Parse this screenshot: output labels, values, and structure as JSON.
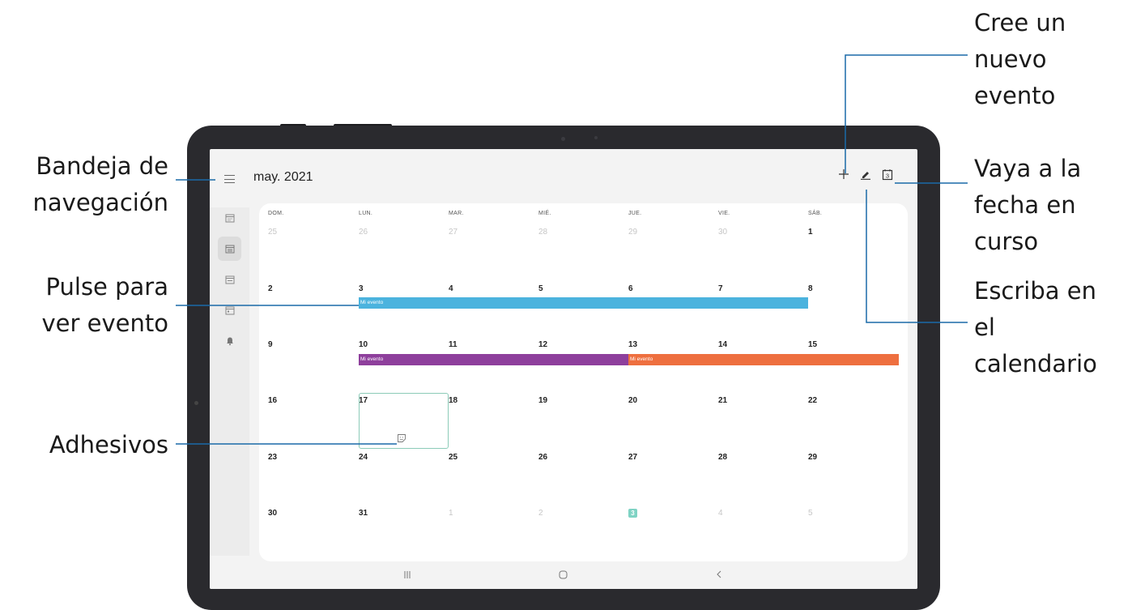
{
  "annotations": {
    "nav_drawer": "Bandeja de\nnavegación",
    "view_event": "Pulse para\nver evento",
    "stickers": "Adhesivos",
    "new_event": "Cree un\nnuevo\nevento",
    "go_today": "Vaya a la\nfecha en\ncurso",
    "write_calendar": "Escriba en\nel\ncalendario"
  },
  "header": {
    "title": "may. 2021",
    "add_icon": "plus-icon",
    "pen_icon": "pen-icon",
    "today_icon_label": "3"
  },
  "weekdays": [
    "DOM.",
    "LUN.",
    "MAR.",
    "MIÉ.",
    "JUE.",
    "VIE.",
    "SÁB."
  ],
  "weeks": [
    [
      "25",
      "26",
      "27",
      "28",
      "29",
      "30",
      "1"
    ],
    [
      "2",
      "3",
      "4",
      "5",
      "6",
      "7",
      "8"
    ],
    [
      "9",
      "10",
      "11",
      "12",
      "13",
      "14",
      "15"
    ],
    [
      "16",
      "17",
      "18",
      "19",
      "20",
      "21",
      "22"
    ],
    [
      "23",
      "24",
      "25",
      "26",
      "27",
      "28",
      "29"
    ],
    [
      "30",
      "31",
      "1",
      "2",
      "3",
      "4",
      "5"
    ]
  ],
  "events": [
    {
      "label": "Mi evento",
      "color": "#4bb3de"
    },
    {
      "label": "Mi evento",
      "color": "#8e3f9c"
    },
    {
      "label": "Mi evento",
      "color": "#ee6f3f"
    }
  ],
  "today_date": "3",
  "colors": {
    "today": "#7fd3c4",
    "sticker_border": "#8ccbb8"
  },
  "rail_icons": [
    "calendar-month-icon",
    "calendar-week-icon",
    "calendar-day-icon",
    "calendar-list-icon",
    "bell-icon"
  ],
  "navbar": {
    "recent_icon": "recent-apps-icon",
    "home_icon": "home-icon",
    "back_icon": "back-icon"
  }
}
